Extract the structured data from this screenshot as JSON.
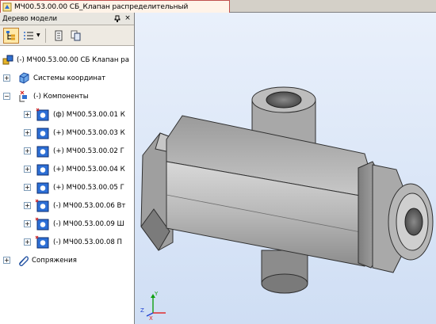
{
  "tab": {
    "title": "МЧ00.53.00.00 СБ_Клапан распределительный",
    "icon": "assembly-doc-icon"
  },
  "panel": {
    "title": "Дерево модели",
    "pin_glyph": "ᴘ",
    "close_glyph": "×",
    "toolbar": [
      "structure-tree-icon",
      "list-filter-icon",
      "notes-icon",
      "copy-icon"
    ]
  },
  "tree": {
    "root": "(-) МЧ00.53.00.00 СБ Клапан ра",
    "coord": "Системы координат",
    "components_group": "(-) Компоненты",
    "components": [
      {
        "label": "(ф) МЧ00.53.00.01 К",
        "status": "fixed"
      },
      {
        "label": "(+) МЧ00.53.00.03 К",
        "status": "plus"
      },
      {
        "label": "(+) МЧ00.53.00.02 Г",
        "status": "plus"
      },
      {
        "label": "(+) МЧ00.53.00.04 К",
        "status": "plus"
      },
      {
        "label": "(+) МЧ00.53.00.05 Г",
        "status": "plus"
      },
      {
        "label": "(-) МЧ00.53.00.06 Вт",
        "status": "minus"
      },
      {
        "label": "(-) МЧ00.53.00.09 Ш",
        "status": "minus"
      },
      {
        "label": "(-) МЧ00.53.00.08 П",
        "status": "minus"
      }
    ],
    "mates": "Сопряжения"
  },
  "viewport": {
    "axes": {
      "x": "X",
      "y": "Y",
      "z": "Z"
    },
    "colors": {
      "x": "#e02020",
      "y": "#10a010",
      "z": "#2040d0"
    }
  }
}
